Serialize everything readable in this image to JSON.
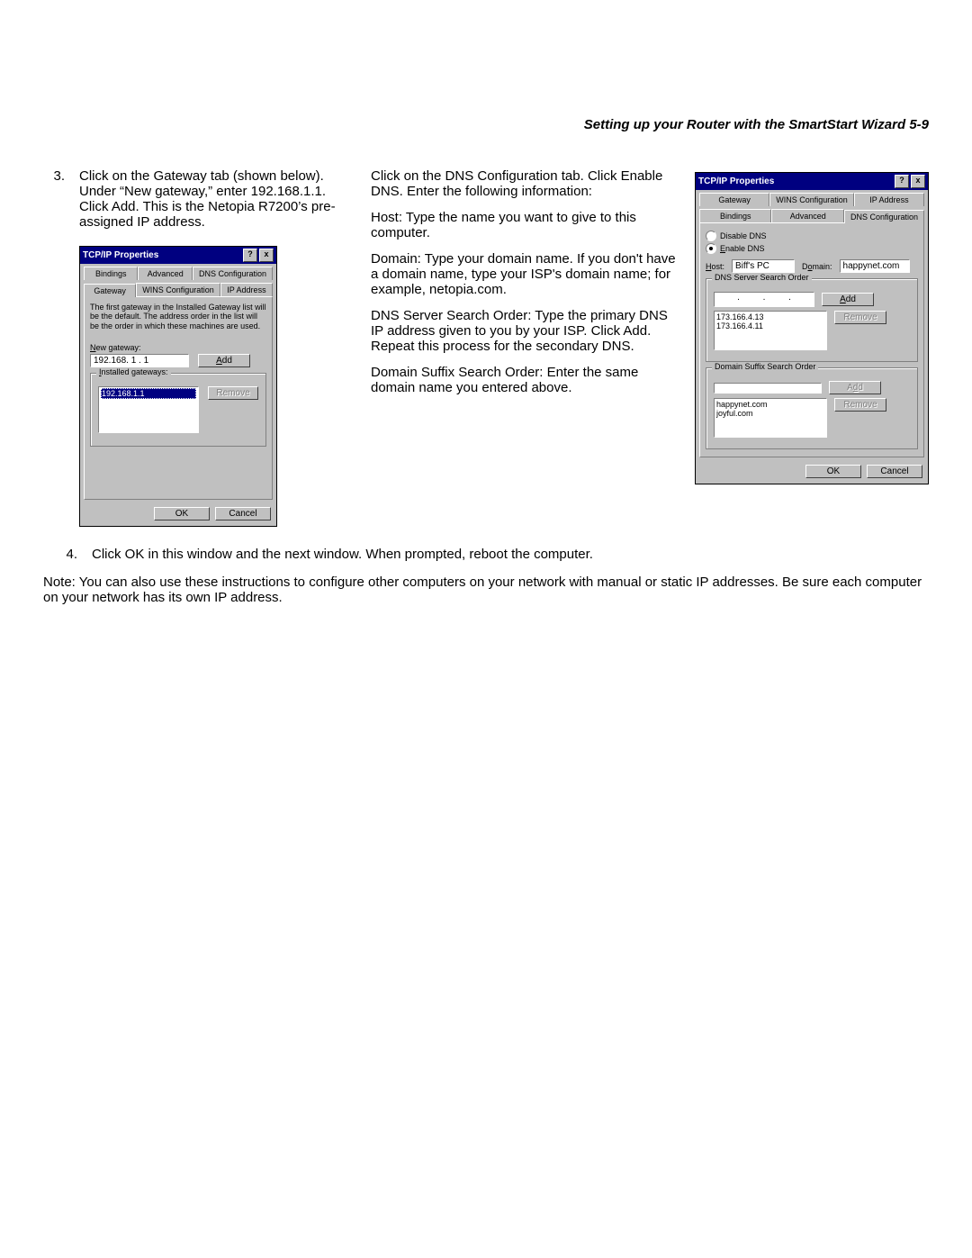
{
  "header": "Setting up your Router with the SmartStart Wizard   5-9",
  "step3": {
    "num": "3.",
    "text": "Click on the Gateway tab (shown below). Under “New gateway,” enter 192.168.1.1. Click Add. This is the Netopia R7200’s pre-assigned IP address."
  },
  "dlg1": {
    "title": "TCP/IP Properties",
    "tabs_top": [
      "Bindings",
      "Advanced",
      "DNS Configuration"
    ],
    "tabs_bottom": [
      "Gateway",
      "WINS Configuration",
      "IP Address"
    ],
    "help": "The first gateway in the Installed Gateway list will be the default. The address order in the list will be the order in which these machines are used.",
    "new_gateway_label": "New gateway:",
    "new_gateway_value": "192.168. 1 . 1",
    "add": "Add",
    "installed_label": "Installed gateways:",
    "installed_value": "192.168.1.1",
    "remove": "Remove",
    "ok": "OK",
    "cancel": "Cancel"
  },
  "right": {
    "p1": "Click on the DNS Configuration tab. Click Enable DNS. Enter the following information:",
    "p2": "Host: Type the name you want to give to this computer.",
    "p3": "Domain: Type your domain name. If you don't have a domain name, type your ISP's domain name; for example, netopia.com.",
    "p4": "DNS Server Search Order: Type the primary DNS IP address given to you by your ISP. Click Add. Repeat this process for the secondary DNS.",
    "p5": "Domain Suffix Search Order: Enter the same domain name you entered above."
  },
  "dlg2": {
    "title": "TCP/IP Properties",
    "tabs_top": [
      "Gateway",
      "WINS Configuration",
      "IP Address"
    ],
    "tabs_bottom": [
      "Bindings",
      "Advanced",
      "DNS Configuration"
    ],
    "disable": "Disable DNS",
    "enable": "Enable DNS",
    "host_label": "Host:",
    "host_value": "Biff's PC",
    "domain_label": "Domain:",
    "domain_value": "happynet.com",
    "dns_order": "DNS Server Search Order",
    "dns_list": [
      "173.166.4.13",
      "173.166.4.11"
    ],
    "add": "Add",
    "remove": "Remove",
    "suffix": "Domain Suffix Search Order",
    "suffix_list": [
      "happynet.com",
      "joyful.com"
    ],
    "ok": "OK",
    "cancel": "Cancel"
  },
  "step4": {
    "num": "4.",
    "text": "Click OK in this window and the next window. When prompted, reboot the computer."
  },
  "note": "Note: You can also use these instructions to configure other computers on your network with manual or static IP addresses. Be sure each computer on your network has its own IP address."
}
